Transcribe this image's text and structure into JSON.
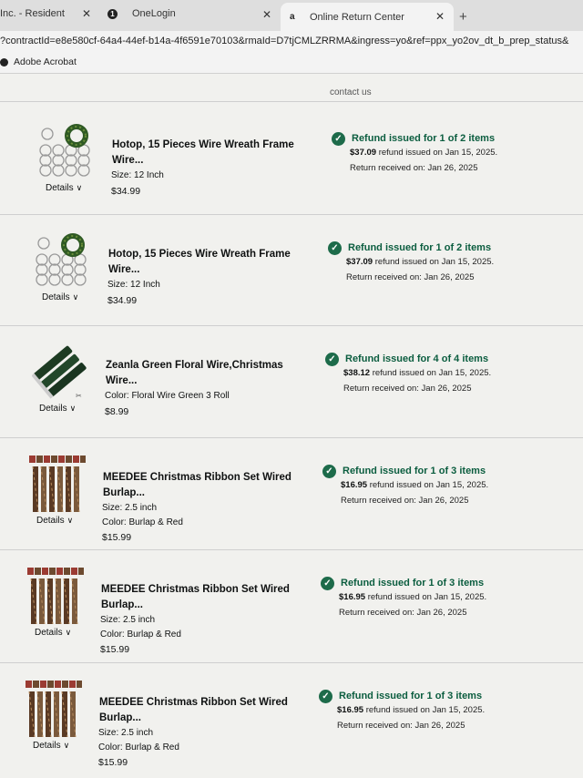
{
  "browser": {
    "tabs": [
      {
        "label": "Inc. - Resident"
      },
      {
        "label": "OneLogin"
      },
      {
        "label": "Online Return Center"
      }
    ],
    "url": "?contractId=e8e580cf-64a4-44ef-b14a-4f6591e70103&rmaId=D7tjCMLZRRMA&ingress=yo&ref=ppx_yo2ov_dt_b_prep_status&",
    "bookmark": "Adobe Acrobat"
  },
  "page": {
    "contact_link": "contact us"
  },
  "details_label": "Details",
  "items": [
    {
      "title_line1": "Hotop, 15 Pieces Wire Wreath Frame",
      "title_line2": "Wire...",
      "attr1": "Size: 12 Inch",
      "attr2": "",
      "price": "$34.99",
      "thumb": "wreath-frame",
      "status_title": "Refund issued for 1 of 2 items",
      "refund_amount": "$37.09",
      "refund_text": " refund issued on Jan 15, 2025.",
      "return_text": "Return received on: Jan 26, 2025"
    },
    {
      "title_line1": "Hotop, 15 Pieces Wire Wreath Frame",
      "title_line2": "Wire...",
      "attr1": "Size: 12 Inch",
      "attr2": "",
      "price": "$34.99",
      "thumb": "wreath-frame",
      "status_title": "Refund issued for 1 of 2 items",
      "refund_amount": "$37.09",
      "refund_text": " refund issued on Jan 15, 2025.",
      "return_text": "Return received on: Jan 26, 2025"
    },
    {
      "title_line1": "Zeanla Green Floral Wire,Christmas",
      "title_line2": "Wire...",
      "attr1": "Color: Floral Wire Green 3 Roll",
      "attr2": "",
      "price": "$8.99",
      "thumb": "floral-wire",
      "status_title": "Refund issued for 4 of 4 items",
      "refund_amount": "$38.12",
      "refund_text": " refund issued on Jan 15, 2025.",
      "return_text": "Return received on: Jan 26, 2025"
    },
    {
      "title_line1": "MEEDEE Christmas Ribbon Set Wired",
      "title_line2": "Burlap...",
      "attr1": "Size: 2.5 inch",
      "attr2": "Color: Burlap & Red",
      "price": "$15.99",
      "thumb": "ribbon-set",
      "status_title": "Refund issued for 1 of 3 items",
      "refund_amount": "$16.95",
      "refund_text": " refund issued on Jan 15, 2025.",
      "return_text": "Return received on: Jan 26, 2025"
    },
    {
      "title_line1": "MEEDEE Christmas Ribbon Set Wired",
      "title_line2": "Burlap...",
      "attr1": "Size: 2.5 inch",
      "attr2": "Color: Burlap & Red",
      "price": "$15.99",
      "thumb": "ribbon-set",
      "status_title": "Refund issued for 1 of 3 items",
      "refund_amount": "$16.95",
      "refund_text": " refund issued on Jan 15, 2025.",
      "return_text": "Return received on: Jan 26, 2025"
    },
    {
      "title_line1": "MEEDEE Christmas Ribbon Set Wired",
      "title_line2": "Burlap...",
      "attr1": "Size: 2.5 inch",
      "attr2": "Color: Burlap & Red",
      "price": "$15.99",
      "thumb": "ribbon-set",
      "status_title": "Refund issued for 1 of 3 items",
      "refund_amount": "$16.95",
      "refund_text": " refund issued on Jan 15, 2025.",
      "return_text": "Return received on: Jan 26, 2025"
    }
  ],
  "colors": {
    "refund_green": "#0b5d3f",
    "check_green": "#1d6b4a"
  }
}
